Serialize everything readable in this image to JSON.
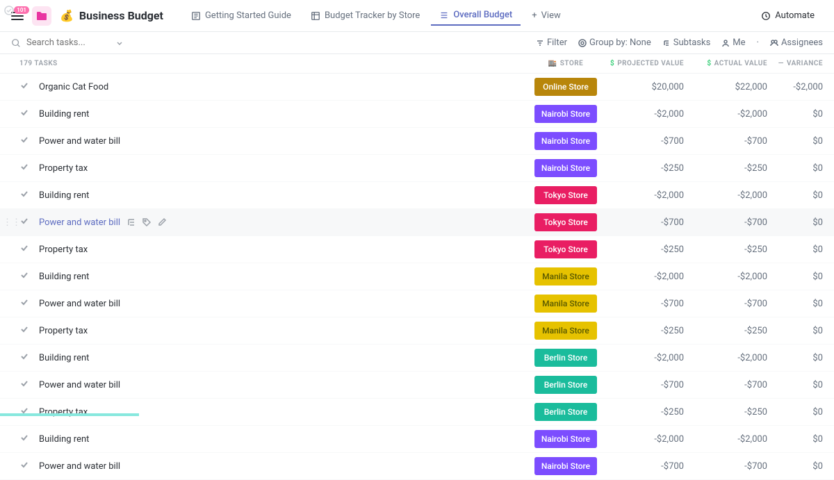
{
  "header": {
    "badge": "101",
    "emoji": "💰",
    "title": "Business Budget"
  },
  "tabs": {
    "t0": "Getting Started Guide",
    "t1": "Budget Tracker by Store",
    "t2": "Overall Budget",
    "t3": "View"
  },
  "automate": "Automate",
  "search": {
    "placeholder": "Search tasks..."
  },
  "toolbar": {
    "filter": "Filter",
    "groupby": "Group by: None",
    "subtasks": "Subtasks",
    "me": "Me",
    "assignees": "Assignees"
  },
  "columns": {
    "tasks": "179 TASKS",
    "store": "STORE",
    "projected": "PROJECTED VALUE",
    "actual": "ACTUAL VALUE",
    "variance": "VARIANCE"
  },
  "stores": {
    "online": {
      "label": "Online Store",
      "color": "#b8860b"
    },
    "nairobi": {
      "label": "Nairobi Store",
      "color": "#7c4dff"
    },
    "tokyo": {
      "label": "Tokyo Store",
      "color": "#e91e63"
    },
    "manila": {
      "label": "Manila Store",
      "color": "#e6c200",
      "text": "#5a5a00"
    },
    "berlin": {
      "label": "Berlin Store",
      "color": "#1abc9c"
    }
  },
  "rows": [
    {
      "name": "Organic Cat Food",
      "store": "online",
      "projected": "$20,000",
      "actual": "$22,000",
      "variance": "-$2,000"
    },
    {
      "name": "Building rent",
      "store": "nairobi",
      "projected": "-$2,000",
      "actual": "-$2,000",
      "variance": "$0"
    },
    {
      "name": "Power and water bill",
      "store": "nairobi",
      "projected": "-$700",
      "actual": "-$700",
      "variance": "$0"
    },
    {
      "name": "Property tax",
      "store": "nairobi",
      "projected": "-$250",
      "actual": "-$250",
      "variance": "$0"
    },
    {
      "name": "Building rent",
      "store": "tokyo",
      "projected": "-$2,000",
      "actual": "-$2,000",
      "variance": "$0"
    },
    {
      "name": "Power and water bill",
      "store": "tokyo",
      "projected": "-$700",
      "actual": "-$700",
      "variance": "$0",
      "hovered": true
    },
    {
      "name": "Property tax",
      "store": "tokyo",
      "projected": "-$250",
      "actual": "-$250",
      "variance": "$0"
    },
    {
      "name": "Building rent",
      "store": "manila",
      "projected": "-$2,000",
      "actual": "-$2,000",
      "variance": "$0"
    },
    {
      "name": "Power and water bill",
      "store": "manila",
      "projected": "-$700",
      "actual": "-$700",
      "variance": "$0"
    },
    {
      "name": "Property tax",
      "store": "manila",
      "projected": "-$250",
      "actual": "-$250",
      "variance": "$0"
    },
    {
      "name": "Building rent",
      "store": "berlin",
      "projected": "-$2,000",
      "actual": "-$2,000",
      "variance": "$0"
    },
    {
      "name": "Power and water bill",
      "store": "berlin",
      "projected": "-$700",
      "actual": "-$700",
      "variance": "$0"
    },
    {
      "name": "Property tax",
      "store": "berlin",
      "projected": "-$250",
      "actual": "-$250",
      "variance": "$0"
    },
    {
      "name": "Building rent",
      "store": "nairobi",
      "projected": "-$2,000",
      "actual": "-$2,000",
      "variance": "$0"
    },
    {
      "name": "Power and water bill",
      "store": "nairobi",
      "projected": "-$700",
      "actual": "-$700",
      "variance": "$0"
    }
  ]
}
